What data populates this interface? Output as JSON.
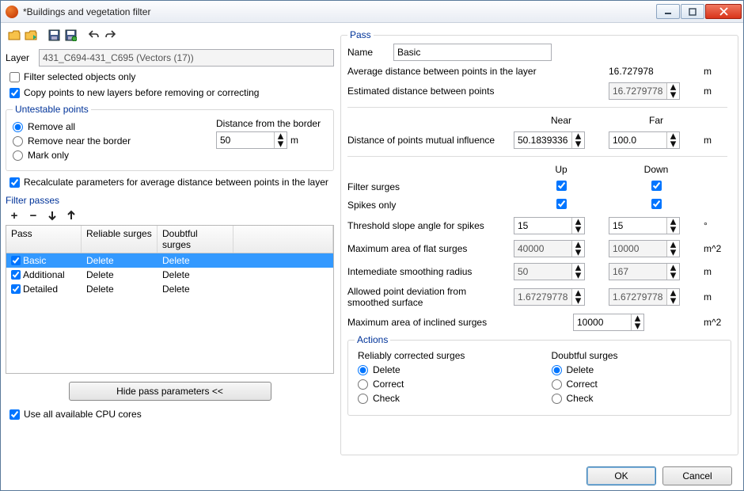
{
  "window": {
    "title": "*Buildings and vegetation filter"
  },
  "winbtns": {
    "min": "–",
    "max": "☐",
    "close": "✕"
  },
  "left": {
    "layer_label": "Layer",
    "layer_value": "431_C694-431_C695 (Vectors (17))",
    "filter_selected": "Filter selected objects only",
    "copy_points": "Copy points to new layers before removing or correcting",
    "untestable": {
      "legend": "Untestable points",
      "remove_all": "Remove all",
      "remove_near": "Remove near the border",
      "mark_only": "Mark only",
      "dist_label": "Distance from the border",
      "dist_value": "50",
      "dist_unit": "m"
    },
    "recalc": "Recalculate parameters for average distance between points in the layer",
    "passes_label": "Filter passes",
    "table": {
      "col_pass": "Pass",
      "col_rel": "Reliable surges",
      "col_doubt": "Doubtful surges",
      "rows": [
        {
          "name": "Basic",
          "rel": "Delete",
          "doubt": "Delete",
          "checked": true,
          "selected": true
        },
        {
          "name": "Additional",
          "rel": "Delete",
          "doubt": "Delete",
          "checked": true,
          "selected": false
        },
        {
          "name": "Detailed",
          "rel": "Delete",
          "doubt": "Delete",
          "checked": true,
          "selected": false
        }
      ]
    },
    "hide_btn": "Hide pass parameters <<",
    "use_cpu": "Use all available CPU cores"
  },
  "pass": {
    "legend": "Pass",
    "name_label": "Name",
    "name_value": "Basic",
    "avg_label": "Average distance between points in the layer",
    "avg_value": "16.727978",
    "est_label": "Estimated distance between points",
    "est_value": "16.7279778",
    "near": "Near",
    "far": "Far",
    "dist_mut": "Distance of points mutual influence",
    "dist_near": "50.18393365",
    "dist_far": "100.0",
    "up": "Up",
    "down": "Down",
    "filter_surges": "Filter surges",
    "spikes_only": "Spikes only",
    "threshold": "Threshold slope angle for spikes",
    "thr_up": "15",
    "thr_down": "15",
    "max_flat": "Maximum area of flat surges",
    "max_flat_up": "40000",
    "max_flat_down": "10000",
    "inter_smooth": "Intemediate smoothing radius",
    "smooth_up": "50",
    "smooth_down": "167",
    "allowed_dev": "Allowed point deviation from smoothed surface",
    "dev_up": "1.672797788",
    "dev_down": "1.672797788",
    "max_incl": "Maximum area of inclined surges",
    "max_incl_val": "10000",
    "unit_m": "m",
    "unit_m2": "m^2",
    "unit_deg": "°"
  },
  "actions": {
    "legend": "Actions",
    "rel_hdr": "Reliably corrected surges",
    "doubt_hdr": "Doubtful surges",
    "delete": "Delete",
    "correct": "Correct",
    "check": "Check"
  },
  "footer": {
    "ok": "OK",
    "cancel": "Cancel"
  }
}
